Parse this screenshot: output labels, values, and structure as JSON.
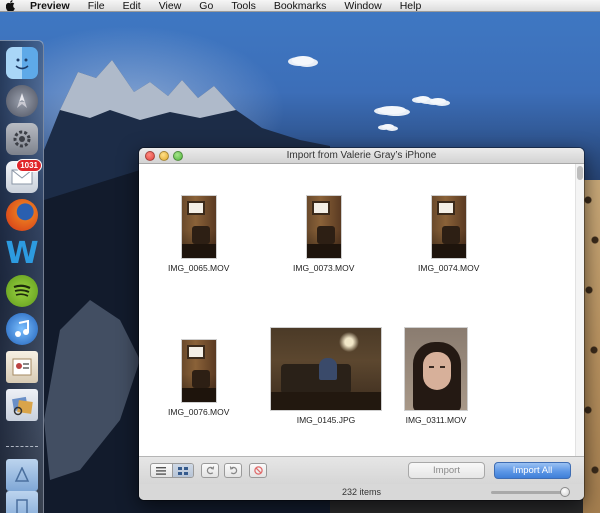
{
  "menubar": {
    "app_name": "Preview",
    "menus": [
      "File",
      "Edit",
      "View",
      "Go",
      "Tools",
      "Bookmarks",
      "Window",
      "Help"
    ]
  },
  "dock": {
    "items": [
      {
        "name": "finder-icon",
        "color": "#5ea9e8"
      },
      {
        "name": "launchpad-icon",
        "color": "#6d6d78"
      },
      {
        "name": "system-preferences-icon",
        "color": "#8c8c94"
      },
      {
        "name": "mail-icon",
        "color": "#e9edf2"
      },
      {
        "name": "firefox-icon",
        "color": "#e8731f"
      },
      {
        "name": "word-w-icon",
        "color": "#1f8ed6"
      },
      {
        "name": "spotify-icon",
        "color": "#82c12c"
      },
      {
        "name": "itunes-icon",
        "color": "#2f7fd6"
      },
      {
        "name": "contacts-icon",
        "color": "#efe7d8"
      },
      {
        "name": "preview-icon",
        "color": "#d9dfe8"
      }
    ],
    "mail_badge": "1031",
    "folders": [
      {
        "name": "applications-folder-icon"
      },
      {
        "name": "documents-folder-icon"
      },
      {
        "name": "downloads-folder-icon"
      }
    ]
  },
  "window": {
    "title": "Import from Valerie Gray’s iPhone",
    "items": [
      {
        "filename": "IMG_0065.MOV",
        "kind": "video"
      },
      {
        "filename": "IMG_0073.MOV",
        "kind": "video"
      },
      {
        "filename": "IMG_0074.MOV",
        "kind": "video"
      },
      {
        "filename": "IMG_0076.MOV",
        "kind": "video"
      },
      {
        "filename": "IMG_0145.JPG",
        "kind": "photo-room"
      },
      {
        "filename": "IMG_0311.MOV",
        "kind": "photo-face"
      }
    ],
    "toolbar": {
      "import_label": "Import",
      "import_all_label": "Import All"
    },
    "status": {
      "item_count": "232 items",
      "thumbnail_size_fraction": 0.95
    }
  }
}
